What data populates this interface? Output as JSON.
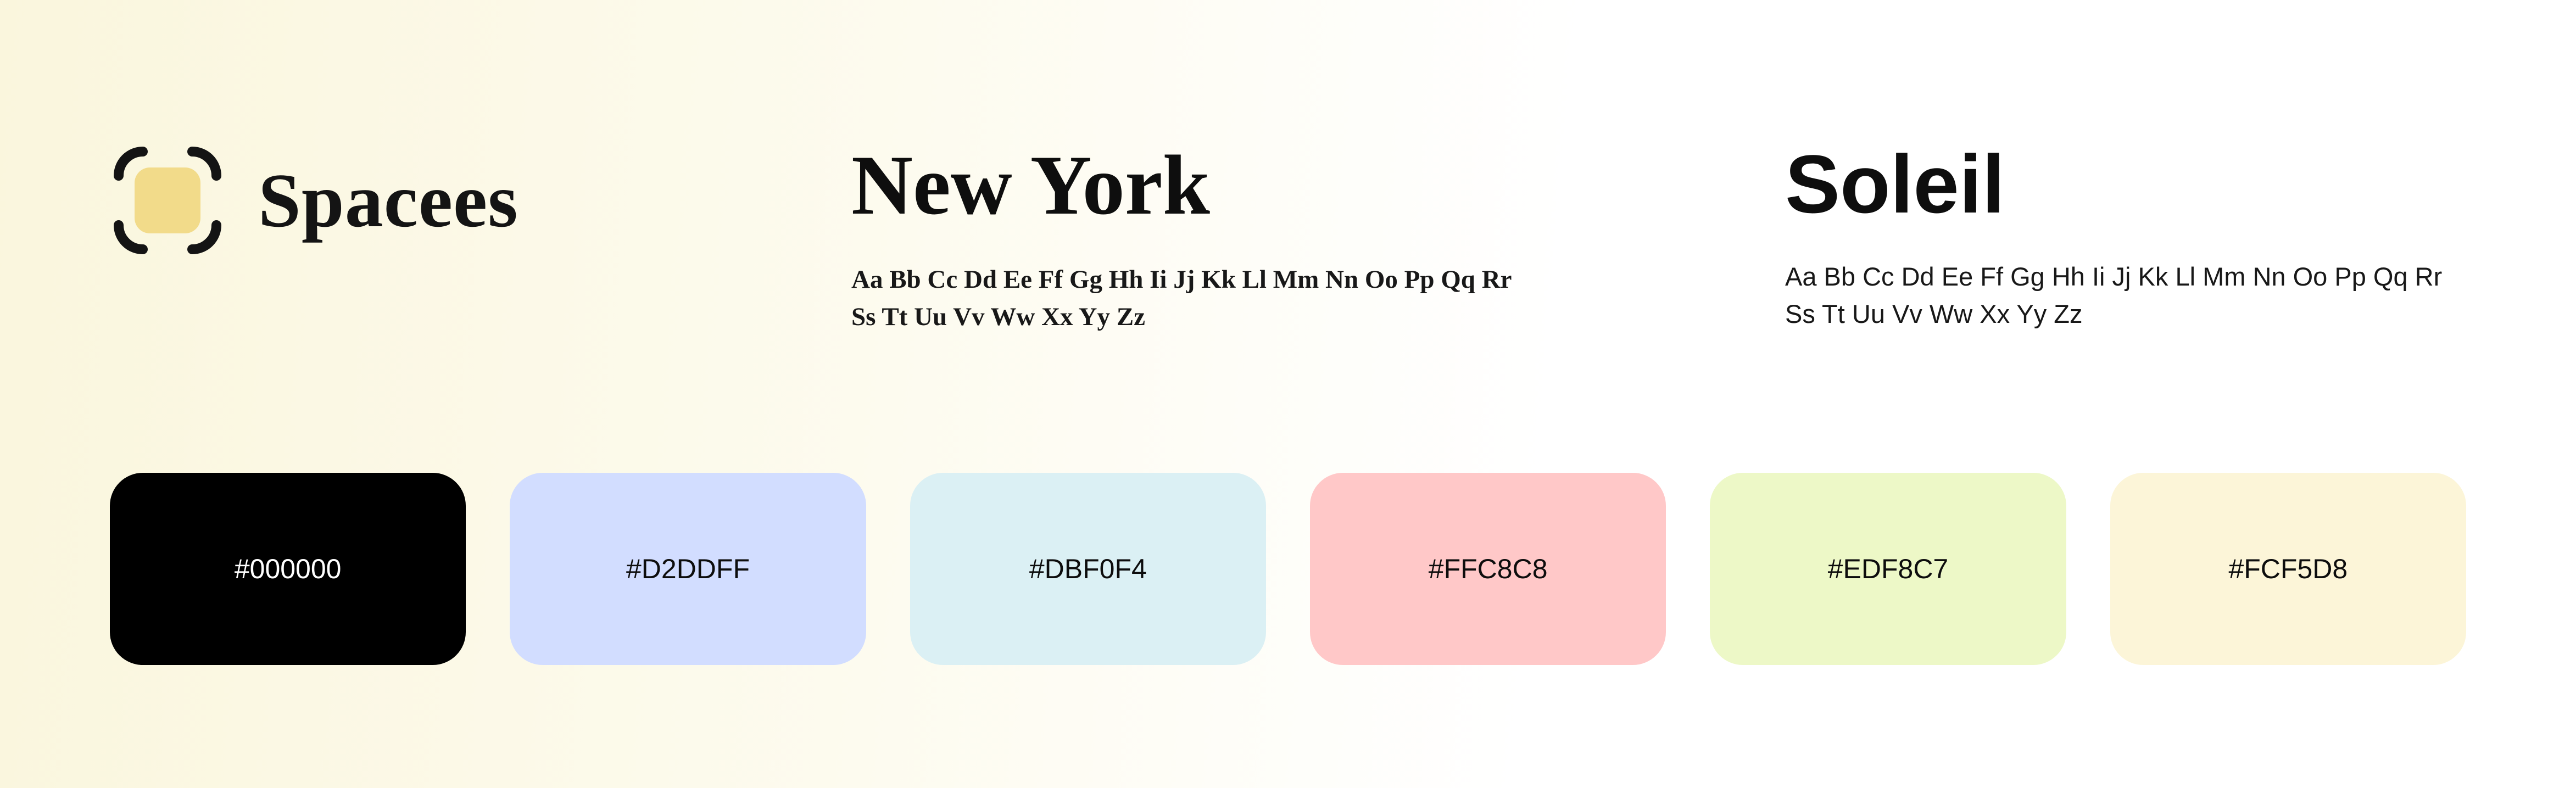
{
  "brand": {
    "name": "Spacees",
    "logo_chip_color": "#f2db8a"
  },
  "typefaces": {
    "serif": {
      "name": "New York",
      "alphabet_line1": "Aa Bb Cc Dd Ee Ff Gg Hh Ii Jj Kk Ll Mm Nn Oo Pp Qq Rr",
      "alphabet_line2": "Ss Tt Uu Vv Ww Xx Yy Zz"
    },
    "sans": {
      "name": "Soleil",
      "alphabet_line1": "Aa Bb Cc Dd Ee Ff Gg Hh Ii Jj Kk Ll Mm Nn Oo Pp Qq Rr",
      "alphabet_line2": "Ss Tt Uu Vv Ww Xx Yy Zz"
    }
  },
  "swatches": [
    {
      "hex": "#000000",
      "text_mode": "dark"
    },
    {
      "hex": "#D2DDFF",
      "text_mode": "light"
    },
    {
      "hex": "#DBF0F4",
      "text_mode": "light"
    },
    {
      "hex": "#FFC8C8",
      "text_mode": "light"
    },
    {
      "hex": "#EDF8C7",
      "text_mode": "light"
    },
    {
      "hex": "#FCF5D8",
      "text_mode": "light"
    }
  ]
}
